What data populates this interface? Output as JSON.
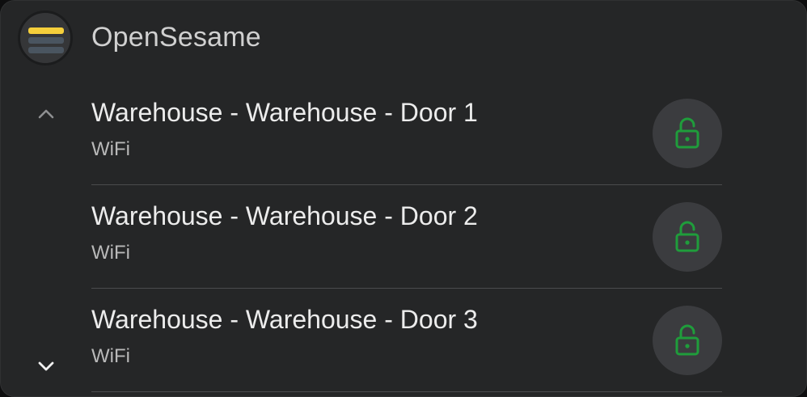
{
  "app": {
    "title": "OpenSesame",
    "icon": "app-logo-icon",
    "logo_colors": [
      "#f5cf3b",
      "#4a5560"
    ]
  },
  "nav": {
    "up_icon": "chevron-up-icon",
    "down_icon": "chevron-down-icon"
  },
  "doors": [
    {
      "name": "Warehouse - Warehouse - Door 1",
      "connection": "WiFi",
      "action_icon": "unlock-icon"
    },
    {
      "name": "Warehouse - Warehouse - Door 2",
      "connection": "WiFi",
      "action_icon": "unlock-icon"
    },
    {
      "name": "Warehouse - Warehouse - Door 3",
      "connection": "WiFi",
      "action_icon": "unlock-icon"
    }
  ],
  "colors": {
    "background": "#252627",
    "unlock_accent": "#1f9d3b",
    "button_bg": "#3b3c3f"
  }
}
